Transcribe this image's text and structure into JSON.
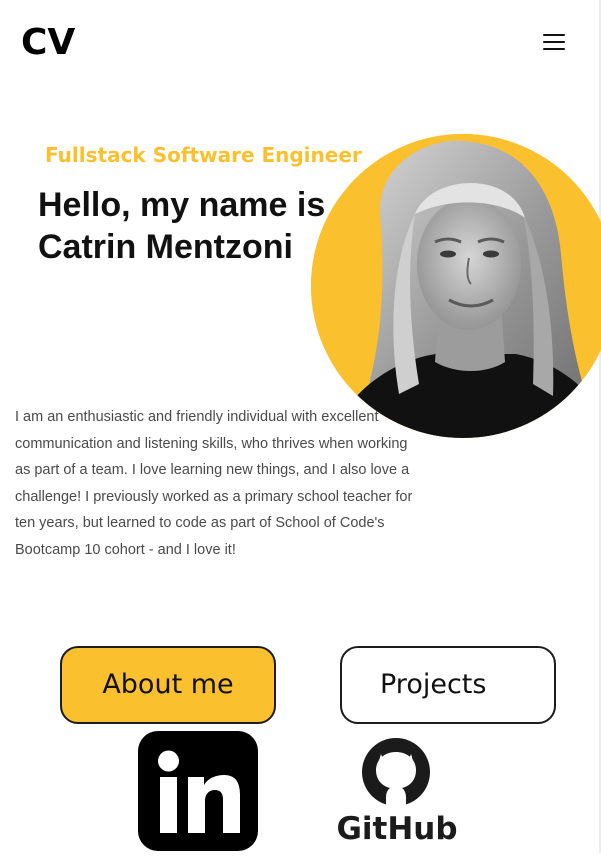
{
  "header": {
    "logo": "CV",
    "menu_icon": "hamburger-menu-icon"
  },
  "hero": {
    "role": "Fullstack Software Engineer",
    "title_line1": "Hello, my name is",
    "title_line2": "Catrin Mentzoni",
    "bio": "I am an enthusiastic and friendly individual with excellent communication and listening skills, who thrives when working as part of a team. I love learning new things, and I also love a challenge! I previously worked as a primary school teacher for ten years, but learned to code as part of School of Code's Bootcamp 10 cohort - and I love it!"
  },
  "buttons": {
    "about_label": "About me",
    "projects_label": "Projects"
  },
  "social": {
    "linkedin_label": "in",
    "linkedin_icon": "linkedin-icon",
    "github_label": "GitHub",
    "github_icon": "github-icon"
  },
  "colors": {
    "accent": "#fbc02d",
    "text": "#111111",
    "body_text": "#4a4a4a",
    "background": "#ffffff"
  }
}
